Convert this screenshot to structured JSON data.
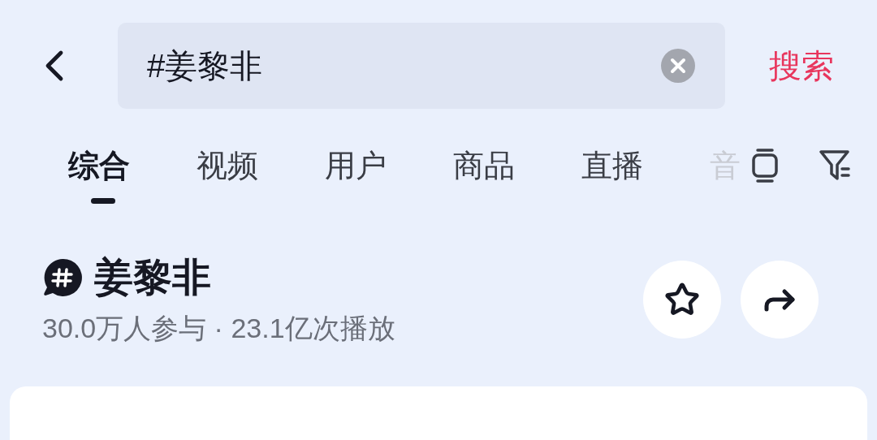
{
  "search": {
    "value": "#姜黎非",
    "button": "搜索"
  },
  "tabs": [
    {
      "label": "综合",
      "selected": true
    },
    {
      "label": "视频",
      "selected": false
    },
    {
      "label": "用户",
      "selected": false
    },
    {
      "label": "商品",
      "selected": false
    },
    {
      "label": "直播",
      "selected": false
    },
    {
      "label": "音",
      "selected": false,
      "faded": true
    }
  ],
  "topic": {
    "title": "姜黎非",
    "stats": "30.0万人参与 · 23.1亿次播放"
  }
}
